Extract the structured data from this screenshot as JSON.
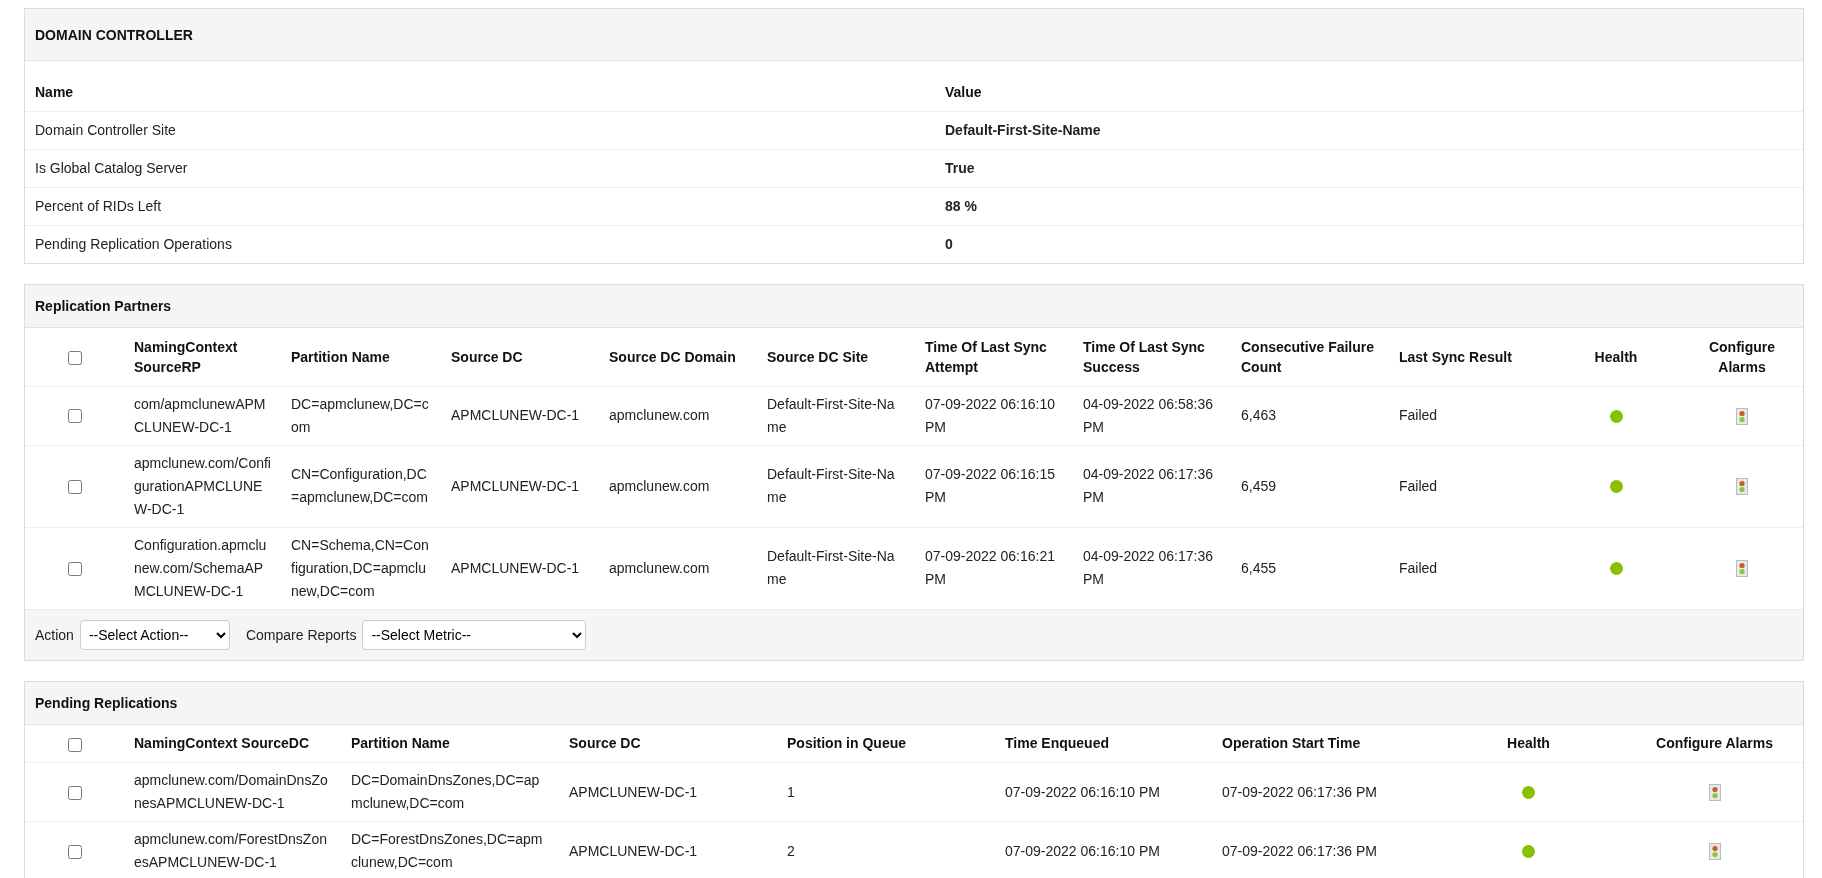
{
  "domain_controller": {
    "title": "DOMAIN CONTROLLER",
    "columns": [
      "Name",
      "Value"
    ],
    "rows": [
      {
        "name": "Domain Controller Site",
        "value": "Default-First-Site-Name"
      },
      {
        "name": "Is Global Catalog Server",
        "value": "True"
      },
      {
        "name": "Percent of RIDs Left",
        "value": "88 %"
      },
      {
        "name": "Pending Replication Operations",
        "value": "0"
      }
    ]
  },
  "replication_partners": {
    "title": "Replication Partners",
    "select_all_checked": false,
    "columns": [
      "NamingContext SourceRP",
      "Partition Name",
      "Source DC",
      "Source DC Domain",
      "Source DC Site",
      "Time Of Last Sync Attempt",
      "Time Of Last Sync Success",
      "Consecutive Failure Count",
      "Last Sync Result",
      "Health",
      "Configure Alarms"
    ],
    "rows": [
      {
        "checked": false,
        "cells": [
          "com/apmclunewAPMCLUNEW-DC-1",
          "DC=apmclunew,DC=com",
          "APMCLUNEW-DC-1",
          "apmclunew.com",
          "Default-First-Site-Name",
          "07-09-2022 06:16:10 PM",
          "04-09-2022 06:58:36 PM",
          "6,463",
          "Failed"
        ],
        "color": "#88c100"
      },
      {
        "checked": false,
        "cells": [
          "apmclunew.com/ConfigurationAPMCLUNEW-DC-1",
          "CN=Configuration,DC=apmclunew,DC=com",
          "APMCLUNEW-DC-1",
          "apmclunew.com",
          "Default-First-Site-Name",
          "07-09-2022 06:16:15 PM",
          "04-09-2022 06:17:36 PM",
          "6,459",
          "Failed"
        ],
        "color": "#88c100"
      },
      {
        "checked": false,
        "cells": [
          "Configuration.apmclunew.com/SchemaAPMCLUNEW-DC-1",
          "CN=Schema,CN=Configuration,DC=apmclunew,DC=com",
          "APMCLUNEW-DC-1",
          "apmclunew.com",
          "Default-First-Site-Name",
          "07-09-2022 06:16:21 PM",
          "04-09-2022 06:17:36 PM",
          "6,455",
          "Failed"
        ],
        "color": "#88c100"
      }
    ],
    "action_label": "Action",
    "action_select": "--Select Action--",
    "compare_label": "Compare Reports",
    "compare_select": "--Select Metric--"
  },
  "pending_replications": {
    "title": "Pending Replications",
    "select_all_checked": false,
    "columns": [
      "NamingContext SourceDC",
      "Partition Name",
      "Source DC",
      "Position in Queue",
      "Time Enqueued",
      "Operation Start Time",
      "Health",
      "Configure Alarms"
    ],
    "rows": [
      {
        "checked": false,
        "cells": [
          "apmclunew.com/DomainDnsZonesAPMCLUNEW-DC-1",
          "DC=DomainDnsZones,DC=apmclunew,DC=com",
          "APMCLUNEW-DC-1",
          "1",
          "07-09-2022 06:16:10 PM",
          "07-09-2022 06:17:36 PM"
        ],
        "color": "#88c100"
      },
      {
        "checked": false,
        "cells": [
          "apmclunew.com/ForestDnsZonesAPMCLUNEW-DC-1",
          "DC=ForestDnsZones,DC=apmclunew,DC=com",
          "APMCLUNEW-DC-1",
          "2",
          "07-09-2022 06:16:10 PM",
          "07-09-2022 06:17:36 PM"
        ],
        "color": "#88c100"
      }
    ]
  }
}
